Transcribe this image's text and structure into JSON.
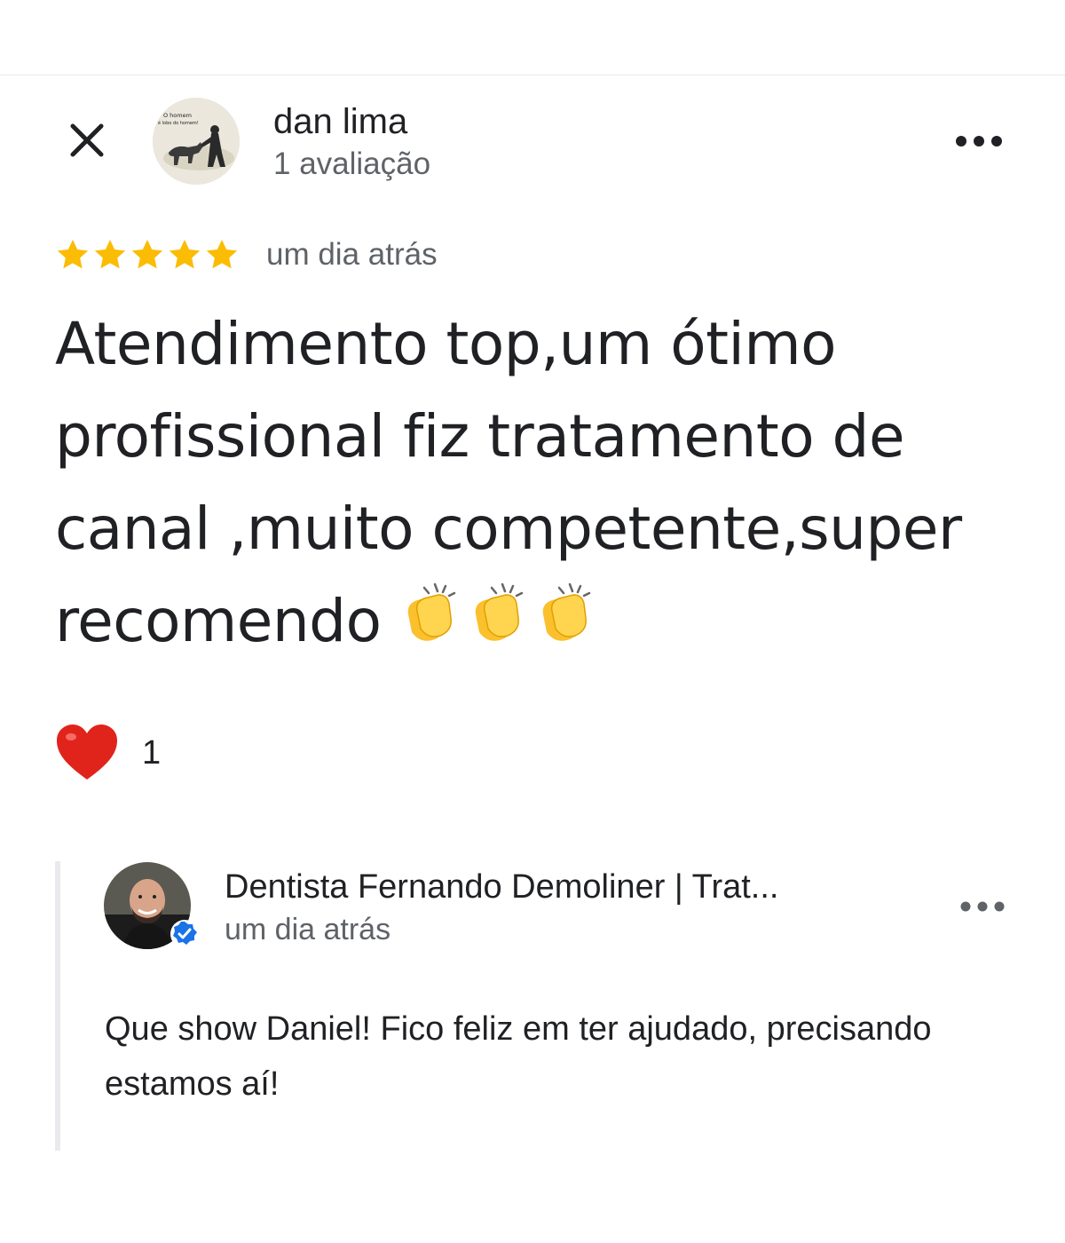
{
  "review": {
    "reviewer_name": "dan lima",
    "reviewer_meta": "1 avaliação",
    "rating": 5,
    "rating_max": 5,
    "date": "um dia atrás",
    "text": "Atendimento top,um ótimo profissional fiz tratamento de canal ,muito competente,super recomendo",
    "clap_emojis": "👏👏👏",
    "avatar_caption_line1": "O homem",
    "avatar_caption_line2": "é lobo do homem!"
  },
  "reactions": {
    "heart_count": "1"
  },
  "reply": {
    "owner_name": "Dentista Fernando Demoliner | Trat...",
    "date": "um dia atrás",
    "text": "Que show Daniel! Fico feliz em ter ajudado, precisando estamos aí!",
    "verified": true
  },
  "icons": {
    "close": "close-icon",
    "more": "more-horizontal-icon",
    "star": "star-icon",
    "heart": "heart-icon",
    "verified": "verified-badge-icon"
  },
  "colors": {
    "star": "#fbbc04",
    "heart": "#e0241b",
    "verified": "#1a73e8",
    "text_primary": "#202124",
    "text_secondary": "#5f6368",
    "divider": "#e8eaed"
  }
}
